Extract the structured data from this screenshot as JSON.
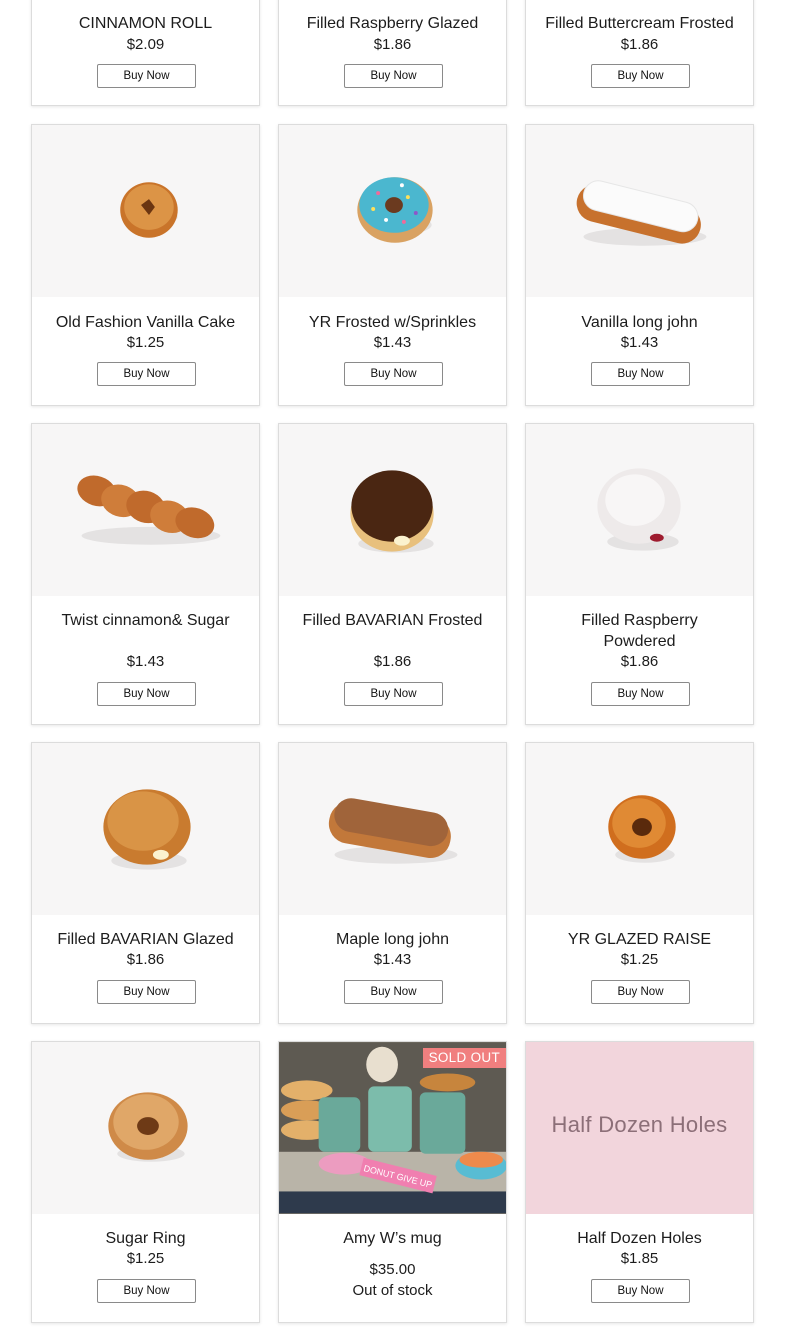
{
  "products": [
    {
      "name": "CINNAMON ROLL",
      "price": "$2.09",
      "button": "Buy Now"
    },
    {
      "name": "Filled Raspberry Glazed",
      "price": "$1.86",
      "button": "Buy Now"
    },
    {
      "name": "Filled Buttercream Frosted",
      "price": "$1.86",
      "button": "Buy Now"
    },
    {
      "name": "Old Fashion Vanilla Cake",
      "price": "$1.25",
      "button": "Buy Now"
    },
    {
      "name": "YR Frosted w/Sprinkles",
      "price": "$1.43",
      "button": "Buy Now"
    },
    {
      "name": "Vanilla long john",
      "price": "$1.43",
      "button": "Buy Now"
    },
    {
      "name": "Twist cinnamon& Sugar",
      "price": "$1.43",
      "button": "Buy Now"
    },
    {
      "name": "Filled BAVARIAN Frosted",
      "price": "$1.86",
      "button": "Buy Now"
    },
    {
      "name": "Filled Raspberry Powdered",
      "price": "$1.86",
      "button": "Buy Now"
    },
    {
      "name": "Filled BAVARIAN Glazed",
      "price": "$1.86",
      "button": "Buy Now"
    },
    {
      "name": "Maple long john",
      "price": "$1.43",
      "button": "Buy Now"
    },
    {
      "name": "YR GLAZED RAISE",
      "price": "$1.25",
      "button": "Buy Now"
    },
    {
      "name": "Sugar Ring",
      "price": "$1.25",
      "button": "Buy Now"
    },
    {
      "name": "Amy W’s mug",
      "price": "$35.00",
      "stock": "Out of stock",
      "badge": "SOLD OUT",
      "photo_sign": "DONUT GIVE UP"
    },
    {
      "name": "Half Dozen Holes",
      "price": "$1.85",
      "button": "Buy Now",
      "placeholder": "Half Dozen Holes",
      "placeholder_color": "#f2d5dc"
    }
  ]
}
